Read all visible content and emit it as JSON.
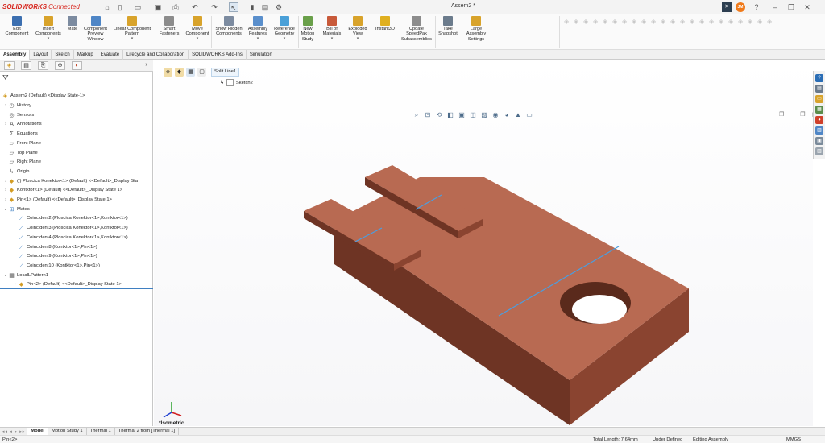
{
  "app": {
    "logo_text": "SOLIDWORKS",
    "logo_suffix": "Connected",
    "document_title": "Assem2 *",
    "user_initials": "JM",
    "console_glyph": ">"
  },
  "ribbon": {
    "buttons": [
      {
        "label": "Edit Component",
        "icon": "edit-component-icon",
        "color": "#3c6fb0"
      },
      {
        "label": "Insert Components",
        "icon": "insert-components-icon",
        "color": "#d8a32b"
      },
      {
        "label": "Mate",
        "icon": "mate-icon",
        "color": "#7c8ba0"
      },
      {
        "label": "Component Preview Window",
        "icon": "preview-window-icon",
        "color": "#4f86c6"
      },
      {
        "label": "Linear Component Pattern",
        "icon": "linear-pattern-icon",
        "color": "#d8a32b"
      },
      {
        "label": "Smart Fasteners",
        "icon": "smart-fasteners-icon",
        "color": "#8c8c8c"
      },
      {
        "label": "Move Component",
        "icon": "move-component-icon",
        "color": "#d8a32b"
      },
      {
        "label": "Show Hidden Components",
        "icon": "show-hidden-icon",
        "color": "#7c8ba0"
      },
      {
        "label": "Assembly Features",
        "icon": "assembly-features-icon",
        "color": "#5a8fcc"
      },
      {
        "label": "Reference Geometry",
        "icon": "reference-geometry-icon",
        "color": "#4aa0d8"
      },
      {
        "label": "New Motion Study",
        "icon": "motion-study-icon",
        "color": "#6aa04a"
      },
      {
        "label": "Bill of Materials",
        "icon": "bom-icon",
        "color": "#c85a3a"
      },
      {
        "label": "Exploded View",
        "icon": "exploded-view-icon",
        "color": "#d8a32b"
      },
      {
        "label": "Instant3D",
        "icon": "instant3d-icon",
        "color": "#e0b020"
      },
      {
        "label": "Update SpeedPak Subassemblies",
        "icon": "speedpak-icon",
        "color": "#8c8c8c"
      },
      {
        "label": "Take Snapshot",
        "icon": "snapshot-icon",
        "color": "#6b7b8c"
      },
      {
        "label": "Large Assembly Settings",
        "icon": "large-assembly-icon",
        "color": "#d8a32b"
      }
    ]
  },
  "command_tabs": [
    "Assembly",
    "Layout",
    "Sketch",
    "Markup",
    "Evaluate",
    "Lifecycle and Collaboration",
    "SOLIDWORKS Add-Ins",
    "Simulation"
  ],
  "tree": {
    "root": "Assem2 (Default) <Display State-1>",
    "items": [
      {
        "label": "History",
        "icon": "history-icon",
        "exp": "›"
      },
      {
        "label": "Sensors",
        "icon": "sensors-icon",
        "exp": ""
      },
      {
        "label": "Annotations",
        "icon": "annotations-icon",
        "exp": "›"
      },
      {
        "label": "Equations",
        "icon": "equations-icon",
        "exp": ""
      },
      {
        "label": "Front Plane",
        "icon": "plane-icon",
        "exp": ""
      },
      {
        "label": "Top Plane",
        "icon": "plane-icon",
        "exp": ""
      },
      {
        "label": "Right Plane",
        "icon": "plane-icon",
        "exp": ""
      },
      {
        "label": "Origin",
        "icon": "origin-icon",
        "exp": ""
      },
      {
        "label": "(f) Ploscica Konektor<1> (Default) <<Default>_Display Sta",
        "icon": "part-icon",
        "exp": "›"
      },
      {
        "label": "Kontktor<1> (Default) <<Default>_Display State 1>",
        "icon": "part-icon",
        "exp": "›"
      },
      {
        "label": "Pin<1> (Default) <<Default>_Display State 1>",
        "icon": "part-icon",
        "exp": "›"
      },
      {
        "label": "Mates",
        "icon": "mates-icon",
        "exp": "⌄"
      },
      {
        "label": "Coincident2 (Ploscica Konektor<1>,Kontktor<1>)",
        "icon": "coincident-icon",
        "exp": "",
        "indent": 1
      },
      {
        "label": "Coincident3 (Ploscica Konektor<1>,Kontktor<1>)",
        "icon": "coincident-icon",
        "exp": "",
        "indent": 1
      },
      {
        "label": "Coincident4 (Ploscica Konektor<1>,Kontktor<1>)",
        "icon": "coincident-icon",
        "exp": "",
        "indent": 1
      },
      {
        "label": "Coincident8 (Kontktor<1>,Pin<1>)",
        "icon": "coincident-icon",
        "exp": "",
        "indent": 1
      },
      {
        "label": "Coincident9 (Kontktor<1>,Pin<1>)",
        "icon": "coincident-icon",
        "exp": "",
        "indent": 1
      },
      {
        "label": "Coincident10 (Kontktor<1>,Pin<1>)",
        "icon": "coincident-icon",
        "exp": "",
        "indent": 1
      },
      {
        "label": "LocalLPattern1",
        "icon": "pattern-icon",
        "exp": "⌄"
      },
      {
        "label": "Pin<2> (Default) <<Default>_Display State 1>",
        "icon": "part-icon",
        "exp": "›",
        "indent": 1
      }
    ]
  },
  "viewport": {
    "breadcrumb_item": "Split Line1",
    "breadcrumb_sub": "Sketch2",
    "view_label": "*Isometric",
    "part_color_top": "#b86a52",
    "part_color_front": "#6e3424",
    "part_color_side": "#8a4430",
    "split_line_color": "#4a9ee0"
  },
  "bottom_tabs": [
    "Model",
    "Motion Study 1",
    "Thermal 1",
    "Thermal 2 from [Thermal 1]"
  ],
  "status": {
    "selection": "Pin<2>",
    "total_length": "Total Length: 7.64mm",
    "definition": "Under Defined",
    "mode": "Editing Assembly",
    "units": "MMGS"
  }
}
